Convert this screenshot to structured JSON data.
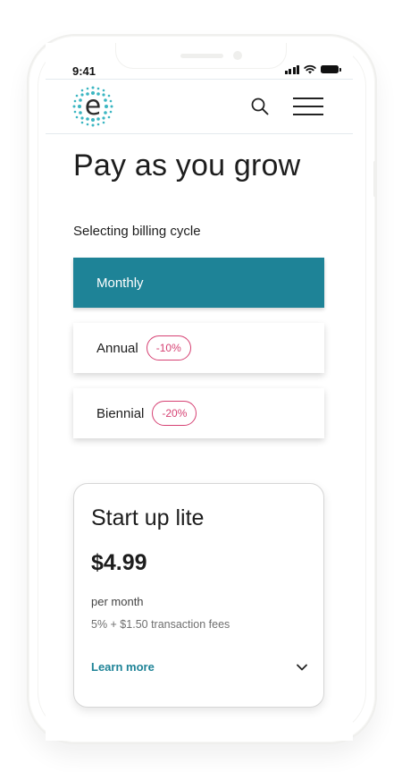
{
  "status_bar": {
    "time": "9:41"
  },
  "navbar": {
    "logo_letter": "e",
    "icons": {
      "search": "search-icon",
      "menu": "hamburger-menu-icon"
    }
  },
  "page": {
    "title": "Pay as you grow",
    "billing_label": "Selecting billing cycle"
  },
  "billing_cycles": [
    {
      "label": "Monthly",
      "selected": true,
      "badge": ""
    },
    {
      "label": "Annual",
      "selected": false,
      "badge": "-10%"
    },
    {
      "label": "Biennial",
      "selected": false,
      "badge": "-20%"
    }
  ],
  "plan": {
    "name": "Start up lite",
    "price": "$4.99",
    "period": "per month",
    "fees": "5% + $1.50 transaction fees",
    "learn_more": "Learn more",
    "expand_icon": "chevron-down-icon"
  },
  "colors": {
    "accent": "#1e8397",
    "badge": "#d64173",
    "logo_dots": "#3cb6c2"
  }
}
